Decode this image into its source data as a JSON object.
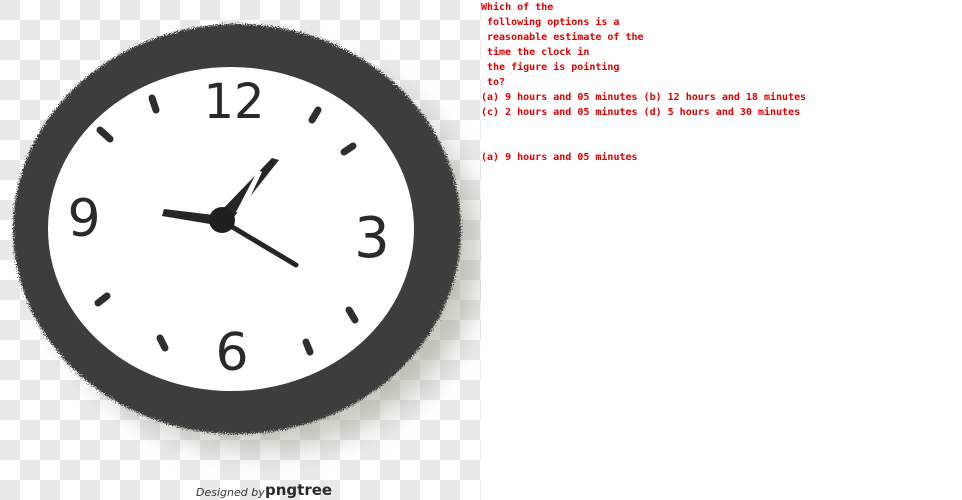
{
  "figure": {
    "watermark_prefix": "Designed by",
    "watermark_brand": "pngtree",
    "clock_numerals": {
      "twelve": "12",
      "three": "3",
      "six": "6",
      "nine": "9"
    }
  },
  "question": {
    "lines": [
      "Which of the",
      "following options is a",
      "reasonable estimate of the",
      "time the clock in",
      "the figure is pointing",
      "to?"
    ],
    "options": [
      "(a) 9 hours and 05 minutes (b) 12 hours and 18 minutes",
      "(c) 2 hours and 05 minutes (d) 5 hours and 30 minutes"
    ],
    "answer": "(a) 9 hours and 05 minutes"
  },
  "colors": {
    "text": "#e00000",
    "clock_rim": "#3d3d3d",
    "checker_light": "#e9e9e9"
  }
}
